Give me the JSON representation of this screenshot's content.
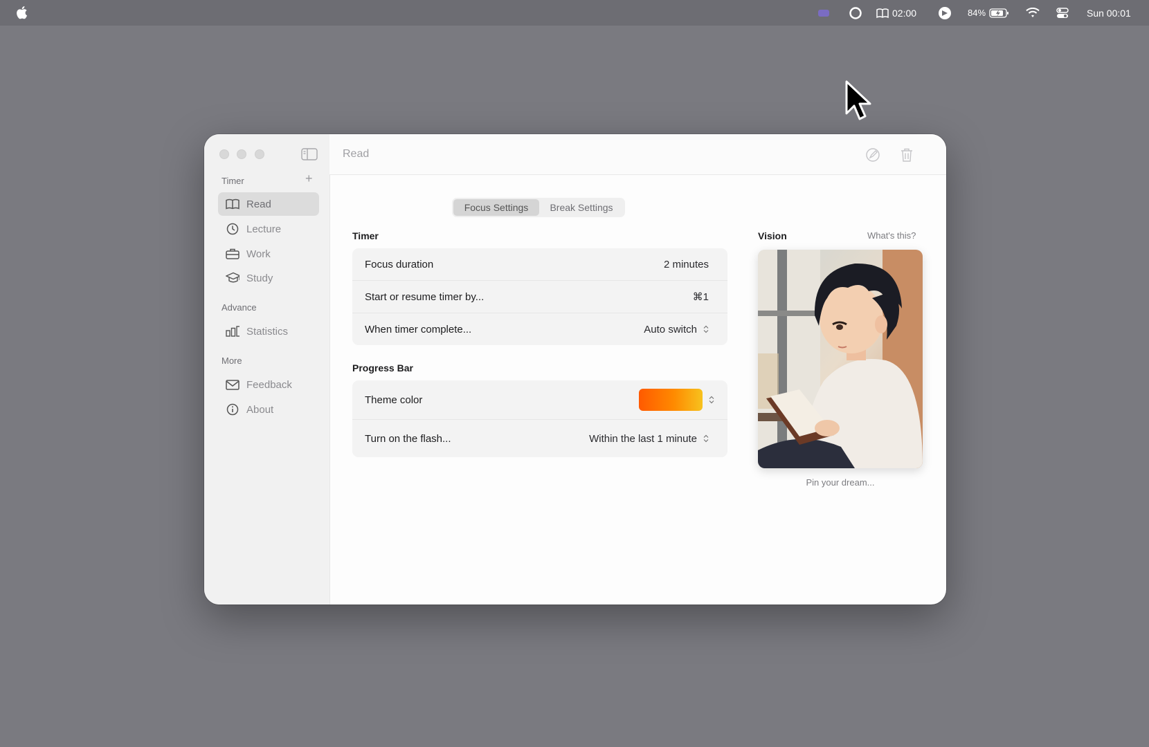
{
  "menubar": {
    "timer_display": "02:00",
    "battery_percent": "84%",
    "clock": "Sun 00:01"
  },
  "window": {
    "title": "Read"
  },
  "sidebar": {
    "sections": {
      "timer": "Timer",
      "advance": "Advance",
      "more": "More"
    },
    "timer_items": [
      {
        "label": "Read",
        "icon": "book-icon"
      },
      {
        "label": "Lecture",
        "icon": "clock-icon"
      },
      {
        "label": "Work",
        "icon": "briefcase-icon"
      },
      {
        "label": "Study",
        "icon": "graduation-cap-icon"
      }
    ],
    "advance_items": [
      {
        "label": "Statistics",
        "icon": "bar-chart-icon"
      }
    ],
    "more_items": [
      {
        "label": "Feedback",
        "icon": "envelope-icon"
      },
      {
        "label": "About",
        "icon": "info-icon"
      }
    ]
  },
  "tabs": [
    {
      "label": "Focus Settings",
      "active": true
    },
    {
      "label": "Break Settings",
      "active": false
    }
  ],
  "timer_section": {
    "title": "Timer",
    "rows": [
      {
        "label": "Focus duration",
        "value": "2 minutes"
      },
      {
        "label": "Start or resume timer by...",
        "value": "⌘1"
      },
      {
        "label": "When timer complete...",
        "value": "Auto switch"
      }
    ]
  },
  "progress_section": {
    "title": "Progress Bar",
    "rows": [
      {
        "label": "Theme color",
        "value": ""
      },
      {
        "label": "Turn on the flash...",
        "value": "Within the last 1 minute"
      }
    ],
    "theme_gradient": [
      "#ff5a00",
      "#ff8a00",
      "#f7c21e"
    ]
  },
  "vision": {
    "title": "Vision",
    "help_link": "What's this?",
    "caption": "Pin your dream..."
  },
  "colors": {
    "desktop": "#7a7a80",
    "sidebar_bg": "#f1f1f1",
    "active_item_bg": "#dcdcdc"
  }
}
